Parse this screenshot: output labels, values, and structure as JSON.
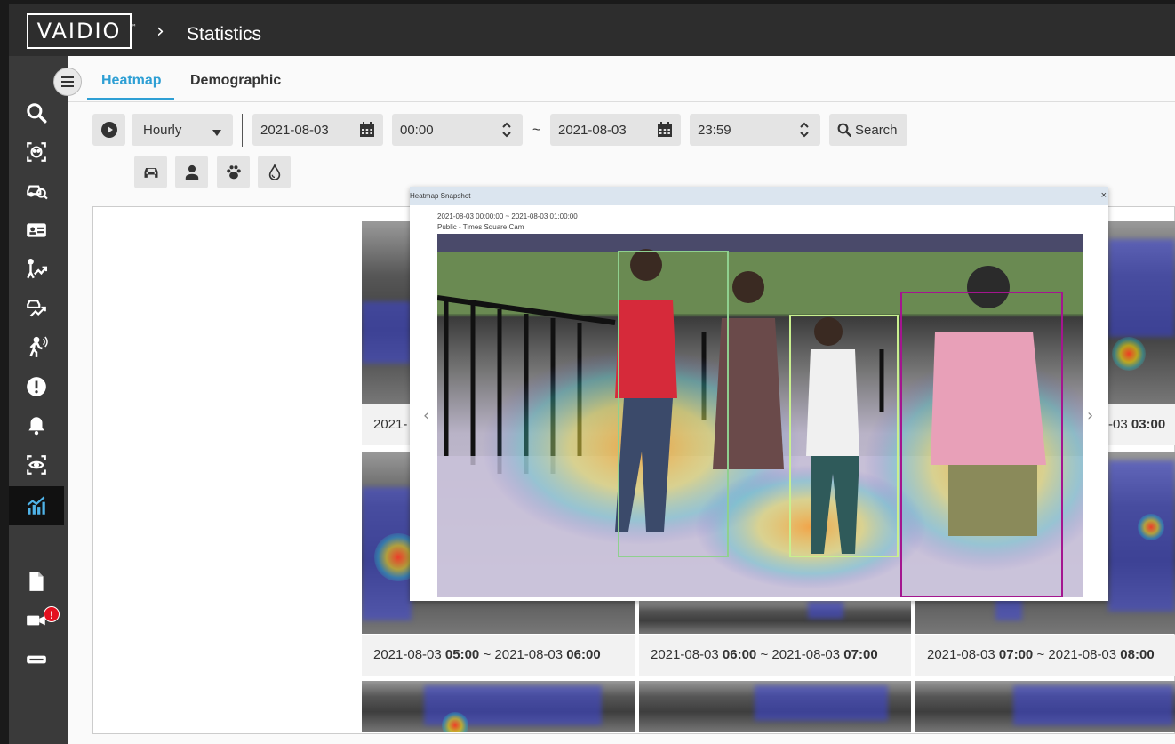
{
  "app": {
    "logo": "VAIDIO",
    "trademark": "™",
    "page_title": "Statistics"
  },
  "tabs": [
    {
      "label": "Heatmap"
    },
    {
      "label": "Demographic"
    }
  ],
  "toolbar": {
    "interval": "Hourly",
    "start_date": "2021-08-03",
    "start_time": "00:00",
    "separator": "~",
    "end_date": "2021-08-03",
    "end_time": "23:59",
    "search_label": "Search"
  },
  "filters": [
    "car-icon",
    "person-icon",
    "paw-icon",
    "drop-icon"
  ],
  "sidebar": {
    "items": [
      "search-icon",
      "face-icon",
      "car-search-icon",
      "id-card-icon",
      "person-trend-icon",
      "car-trend-icon",
      "running-person-icon",
      "alert-icon",
      "bell-icon",
      "eye-scan-icon",
      "statistics-icon",
      "document-icon",
      "camera-icon",
      "device-icon"
    ],
    "camera_badge": "!"
  },
  "thumbnails": {
    "row1": [
      {
        "date": "2021-",
        "hour": ""
      },
      {
        "date": "-03",
        "hour": "03:00"
      }
    ],
    "row2": [
      {
        "start_date": "2021-08-03",
        "start_hour": "05:00",
        "end_date": "2021-08-03",
        "end_hour": "06:00"
      },
      {
        "start_date": "2021-08-03",
        "start_hour": "06:00",
        "end_date": "2021-08-03",
        "end_hour": "07:00"
      },
      {
        "start_date": "2021-08-03",
        "start_hour": "07:00",
        "end_date": "2021-08-03",
        "end_hour": "08:00"
      }
    ]
  },
  "modal": {
    "title": "Heatmap Snapshot",
    "close": "×",
    "range": "2021-08-03 00:00:00 ~ 2021-08-03 01:00:00",
    "camera": "Public - Times Square Cam",
    "prev": "‹",
    "next": "›"
  },
  "colors": {
    "accent": "#2e9fd4",
    "badge": "#e3101f",
    "sidebar": "#3a3a3a"
  }
}
